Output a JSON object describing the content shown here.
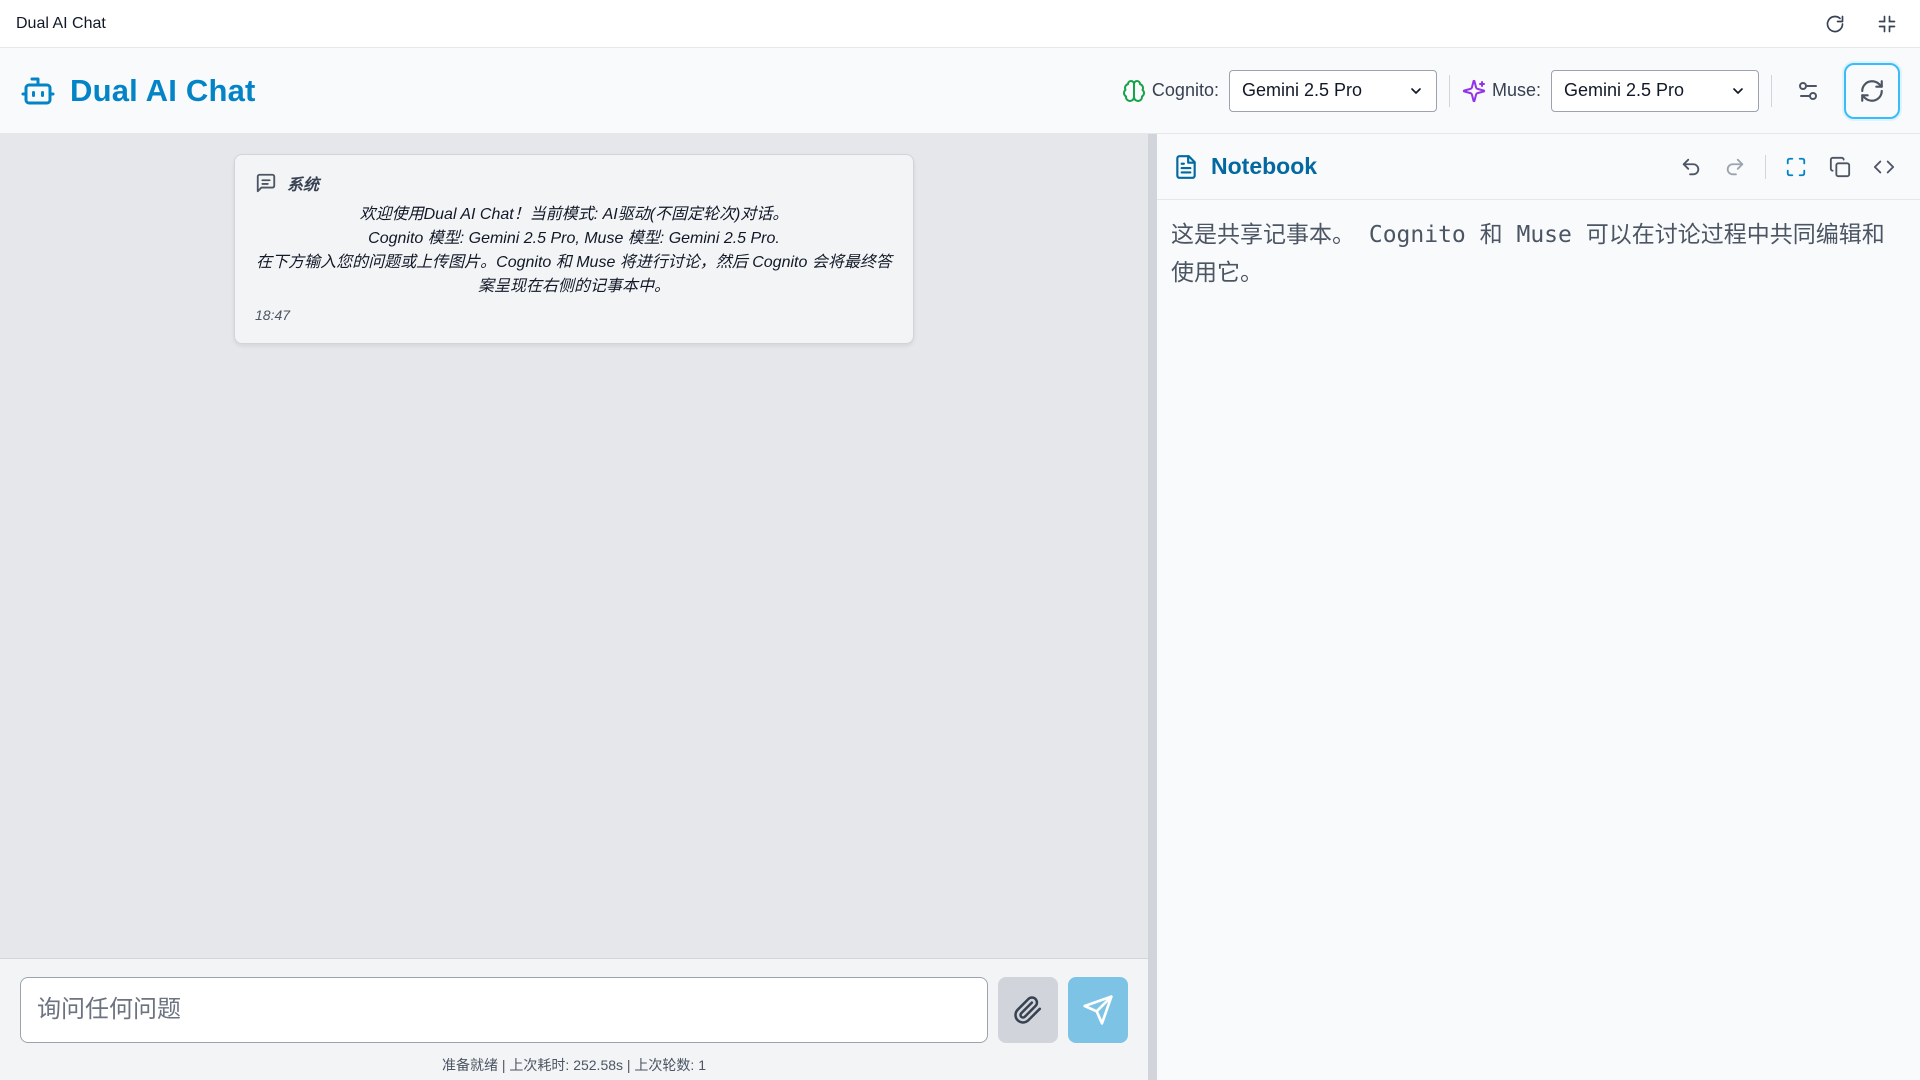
{
  "window": {
    "title": "Dual AI Chat",
    "reload_icon": "reload-icon",
    "collapse_icon": "collapse-icon"
  },
  "header": {
    "app_name": "Dual AI Chat",
    "cognito": {
      "label": "Cognito:",
      "selected": "Gemini 2.5 Pro"
    },
    "muse": {
      "label": "Muse:",
      "selected": "Gemini 2.5 Pro"
    }
  },
  "chat": {
    "messages": [
      {
        "sender": "系统",
        "lines": [
          "欢迎使用Dual AI Chat！当前模式: AI驱动(不固定轮次)对话。",
          "Cognito 模型: Gemini 2.5 Pro, Muse 模型: Gemini 2.5 Pro.",
          "在下方输入您的问题或上传图片。Cognito 和 Muse 将进行讨论，然后 Cognito 会将最终答案呈现在右侧的记事本中。"
        ],
        "time": "18:47"
      }
    ],
    "input_placeholder": "询问任何问题",
    "status": "准备就绪 | 上次耗时: 252.58s | 上次轮数: 1"
  },
  "notebook": {
    "title": "Notebook",
    "content": "这是共享记事本。 Cognito 和 Muse 可以在讨论过程中共同编辑和使用它。"
  },
  "colors": {
    "accent": "#0284c7",
    "cognito_icon": "#16a34a",
    "muse_icon": "#9333ea",
    "send_button": "#7dc3e6"
  }
}
